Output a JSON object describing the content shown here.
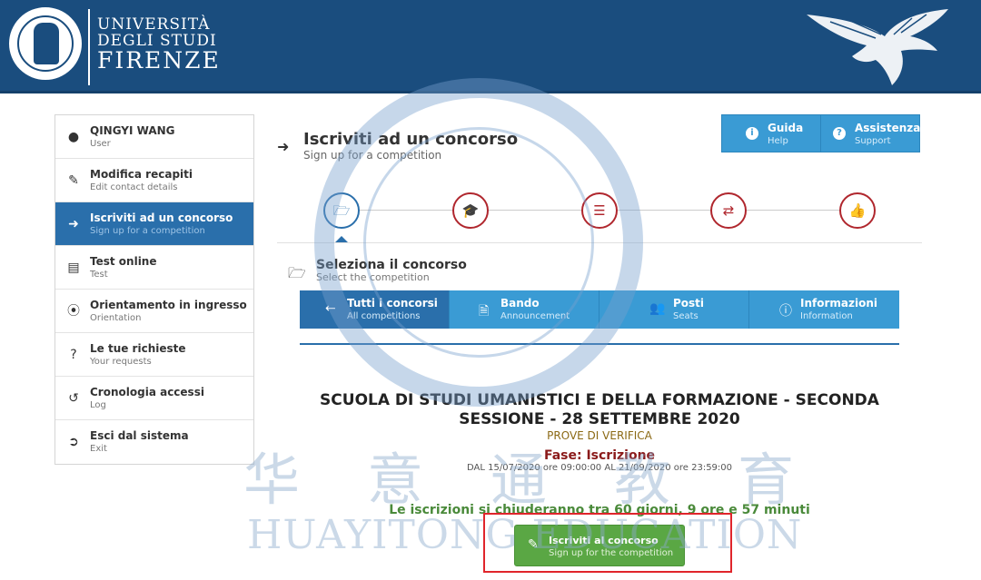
{
  "header": {
    "university_line1": "UNIVERSITÀ",
    "university_line2": "DEGLI STUDI",
    "university_line3": "FIRENZE"
  },
  "sidebar": {
    "items": [
      {
        "label": "QINGYI WANG",
        "sub": "User",
        "icon": "user-icon"
      },
      {
        "label": "Modifica recapiti",
        "sub": "Edit contact details",
        "icon": "edit-icon"
      },
      {
        "label": "Iscriviti ad un concorso",
        "sub": "Sign up for a competition",
        "icon": "sign-in-icon"
      },
      {
        "label": "Test online",
        "sub": "Test",
        "icon": "list-icon"
      },
      {
        "label": "Orientamento in ingresso",
        "sub": "Orientation",
        "icon": "compass-icon"
      },
      {
        "label": "Le tue richieste",
        "sub": "Your requests",
        "icon": "question-icon"
      },
      {
        "label": "Cronologia accessi",
        "sub": "Log",
        "icon": "history-icon"
      },
      {
        "label": "Esci dal sistema",
        "sub": "Exit",
        "icon": "sign-out-icon"
      }
    ]
  },
  "top_buttons": {
    "guida": {
      "label": "Guida",
      "sub": "Help"
    },
    "assistenza": {
      "label": "Assistenza",
      "sub": "Support"
    }
  },
  "page": {
    "title": "Iscriviti ad un concorso",
    "subtitle": "Sign up for a competition"
  },
  "steps": [
    "folder-open-icon",
    "graduation-cap-icon",
    "list-icon",
    "random-icon",
    "thumbs-up-icon"
  ],
  "section": {
    "title": "Seleziona il concorso",
    "subtitle": "Select the competition"
  },
  "tabs": [
    {
      "label": "Tutti i concorsi",
      "sub": "All competitions",
      "icon": "arrow-left-icon"
    },
    {
      "label": "Bando",
      "sub": "Announcement",
      "icon": "document-icon"
    },
    {
      "label": "Posti",
      "sub": "Seats",
      "icon": "users-icon"
    },
    {
      "label": "Informazioni",
      "sub": "Information",
      "icon": "info-icon"
    }
  ],
  "competition": {
    "title_line1": "SCUOLA DI STUDI UMANISTICI E DELLA FORMAZIONE - SECONDA",
    "title_line2": "SESSIONE - 28 SETTEMBRE 2020",
    "type": "PROVE DI VERIFICA",
    "phase": "Fase: Iscrizione",
    "dates": "DAL 15/07/2020 ore 09:00:00 AL 21/09/2020 ore 23:59:00",
    "countdown": "Le iscrizioni si chiuderanno tra 60 giorni, 9 ore e 57 minuti"
  },
  "signup_button": {
    "label": "Iscriviti al concorso",
    "sub": "Sign up for the competition"
  },
  "watermark": {
    "chinese": "华意通教育",
    "english": "HUAYITONG EDUCATION"
  },
  "colors": {
    "header": "#1a4d7e",
    "active": "#2a6fab",
    "button": "#3a9bd4",
    "step_icon": "#b0272e",
    "signup": "#5aa744",
    "highlight": "#e0252b"
  }
}
